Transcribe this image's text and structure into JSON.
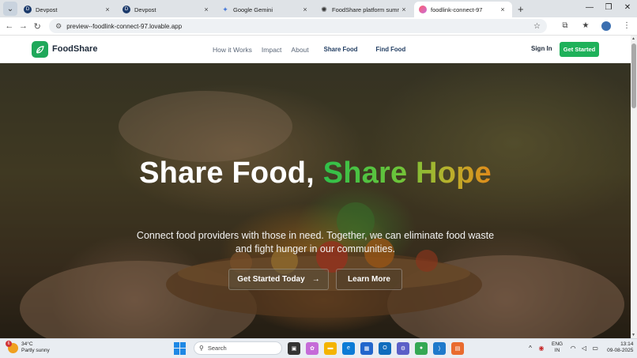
{
  "browser": {
    "tabs": [
      {
        "title": "Devpost",
        "favicon": "devpost-icon",
        "active": false
      },
      {
        "title": "Devpost",
        "favicon": "devpost-icon",
        "active": false
      },
      {
        "title": "Google Gemini",
        "favicon": "gemini-icon",
        "active": false
      },
      {
        "title": "FoodShare platform summary",
        "favicon": "chatgpt-icon",
        "active": false
      },
      {
        "title": "foodlink-connect-97",
        "favicon": "lovable-icon",
        "active": true
      }
    ],
    "new_tab": "+",
    "url": "preview--foodlink-connect-97.lovable.app"
  },
  "site": {
    "brand": "FoodShare",
    "nav": [
      "How it Works",
      "Impact",
      "About",
      "Share Food",
      "Find Food"
    ],
    "sign_in": "Sign In",
    "get_started": "Get Started",
    "hero": {
      "title_plain": "Share Food, ",
      "title_accent": "Share Hope",
      "subtitle": "Connect food providers with those in need. Together, we can eliminate food waste and fight hunger in our communities.",
      "cta_primary": "Get Started Today",
      "cta_secondary": "Learn More"
    },
    "colors": {
      "brand_green": "#1fb15a",
      "accent_gradient_start": "#2fc04a",
      "accent_gradient_end": "#e08a1a"
    }
  },
  "taskbar": {
    "weather": {
      "temp": "34°C",
      "condition": "Partly sunny",
      "badge": "6"
    },
    "search_placeholder": "Search",
    "language": {
      "line1": "ENG",
      "line2": "IN"
    },
    "clock": {
      "time": "13:14",
      "date": "09-08-2025"
    }
  }
}
